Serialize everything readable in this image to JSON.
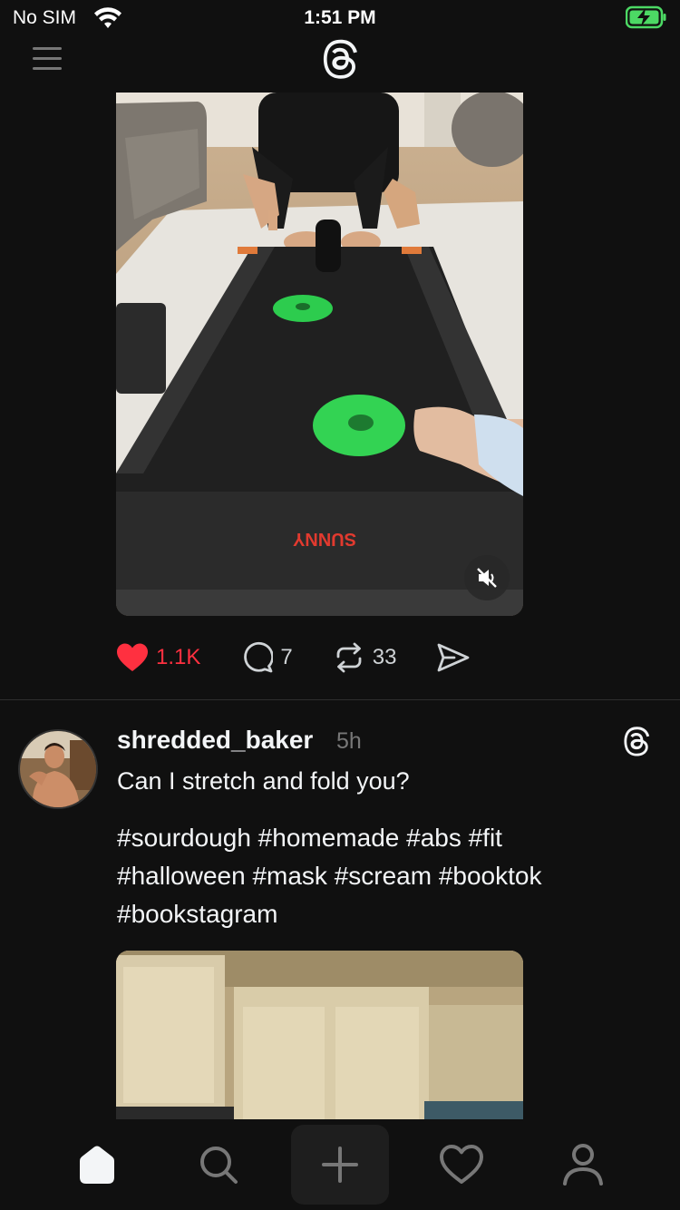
{
  "status_bar": {
    "carrier": "No SIM",
    "time": "1:51 PM"
  },
  "post_1": {
    "media_brand_text": "SUNNY",
    "likes": "1.1K",
    "replies": "7",
    "reposts": "33",
    "liked": true
  },
  "post_2": {
    "username": "shredded_baker",
    "time_ago": "5h",
    "text": "Can I stretch and fold you?",
    "hashtags": "#sourdough #homemade #abs #fit #halloween #mask #scream #booktok #bookstagram"
  },
  "tab_bar": {
    "items": [
      "home-icon",
      "search-icon",
      "create-icon",
      "heart-icon",
      "profile-icon"
    ],
    "active": "home-icon"
  },
  "colors": {
    "background": "#101010",
    "like_red": "#ff3040",
    "text_primary": "#f3f5f7",
    "text_secondary": "#777777",
    "battery_green": "#4cd964"
  }
}
